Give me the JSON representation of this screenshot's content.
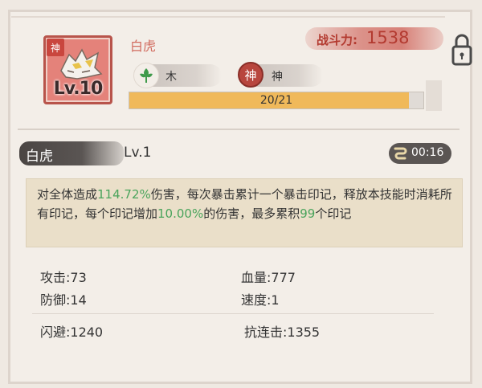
{
  "card": {
    "corner_label": "神",
    "level_text": "Lv.10"
  },
  "hero": {
    "name": "白虎"
  },
  "power": {
    "label": "战斗力:",
    "value": "1538"
  },
  "attributes": [
    {
      "icon": "wood-leaf-icon",
      "label": "木"
    },
    {
      "icon": "divine-emblem-icon",
      "glyph": "神",
      "label": "神"
    }
  ],
  "exp": {
    "text": "20/21",
    "fraction": 0.952
  },
  "skill": {
    "name": "白虎",
    "level": "Lv.1",
    "cooldown": "00:16",
    "desc": {
      "p1": "对全体造成",
      "v1": "114.72%",
      "p2": "伤害，每次暴击累计一个暴击印记，释放本技能时消耗所有印记，每个印记增加",
      "v2": "10.00%",
      "p3": "的伤害，最多累积",
      "v3": "99",
      "p4": "个印记"
    }
  },
  "stats": {
    "attack": "攻击:73",
    "hp": "血量:777",
    "defense": "防御:14",
    "speed": "速度:1",
    "dodge": "闪避:1240",
    "anti_combo": "抗连击:1355"
  },
  "colors": {
    "accent_red": "#b33a30",
    "exp_fill": "#f0b95a",
    "highlight_green": "#4aa45c"
  }
}
